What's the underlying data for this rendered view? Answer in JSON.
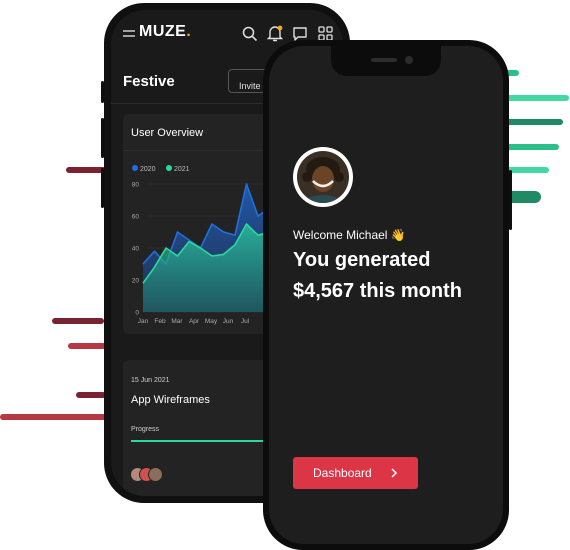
{
  "brand": {
    "name": "MUZE",
    "dot_color": "#f5a623"
  },
  "back_phone": {
    "header_icons": [
      "menu-icon",
      "search-icon",
      "bell-icon",
      "chat-icon",
      "grid-icon"
    ],
    "page_title": "Festive",
    "invite_label": "Invite",
    "overview": {
      "title": "User Overview",
      "chart_data": {
        "type": "area",
        "series": [
          {
            "name": "2020",
            "color": "#1f6fe0",
            "values": [
              30,
              38,
              30,
              50,
              45,
              40,
              55,
              50,
              48,
              80,
              60,
              65
            ]
          },
          {
            "name": "2021",
            "color": "#2bd99f",
            "values": [
              18,
              28,
              40,
              35,
              44,
              40,
              35,
              36,
              42,
              55,
              48,
              50
            ]
          }
        ],
        "x_tick_labels": [
          "Jan",
          "Feb",
          "Mar",
          "Apr",
          "May",
          "Jun",
          "Jul"
        ],
        "y_tick_labels": [
          "0",
          "20",
          "40",
          "60",
          "80"
        ],
        "ylim": [
          0,
          85
        ]
      }
    },
    "project": {
      "date": "15 Jun 2021",
      "title": "App Wireframes",
      "progress_label": "Progress",
      "progress_fraction": 0.72,
      "progress_color": "#2bd99f"
    },
    "team": {
      "avatar_colors": [
        "#b08a7a",
        "#d05050",
        "#8a6d5a"
      ]
    }
  },
  "front_phone": {
    "welcome_text": "Welcome Michael",
    "wave_emoji": "👋",
    "headline_line1": "You generated",
    "headline_line2": "$4,567 this month",
    "cta_label": "Dashboard",
    "cta_color": "#dc3545"
  },
  "colors": {
    "accent_red": "#8b2530",
    "accent_green": "#2bc08a"
  }
}
